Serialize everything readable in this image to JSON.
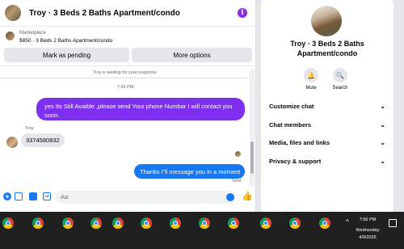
{
  "header": {
    "title": "Troy · 3 Beds 2 Baths Apartment/condo",
    "info_icon": "info-icon",
    "accent": "#8a2be2"
  },
  "listing": {
    "source": "Marketplace",
    "detail": "$850 · 3 Beds 2 Baths Apartment/condo",
    "pending_button": "Mark as pending",
    "more_button": "More options"
  },
  "messages": {
    "waiting": "Troy is waiting for your response.",
    "timestamp": "7:34 PM",
    "outgoing_1": "yes Its Still Avaible ,please send Your phone Numbar I will contact you soon.",
    "sender": "Troy",
    "incoming_1": "3374580832",
    "outgoing_2": "Thanks i\"ll message you in a moment",
    "sent_status": "Sent",
    "outgoing_color": "#7e2ff0",
    "outgoing_color_2": "#1877f2"
  },
  "composer": {
    "placeholder": "Aa"
  },
  "details": {
    "name": "Troy · 3 Beds 2 Baths Apartment/condo",
    "mute": "Mute",
    "search": "Search",
    "sections": [
      "Customize chat",
      "Chat members",
      "Media, files and links",
      "Privacy & support"
    ]
  },
  "taskbar": {
    "time": "7:56 PM",
    "day": "Wednesday",
    "date": "4/9/2025",
    "app_icon": "chrome-icon"
  }
}
